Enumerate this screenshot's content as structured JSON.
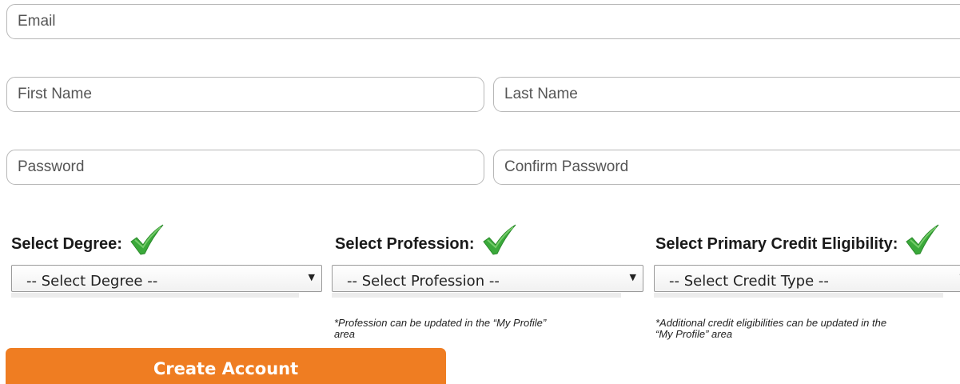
{
  "form": {
    "email": {
      "placeholder": "Email",
      "value": ""
    },
    "first_name": {
      "placeholder": "First Name",
      "value": ""
    },
    "last_name": {
      "placeholder": "Last Name",
      "value": ""
    },
    "password": {
      "placeholder": "Password",
      "value": ""
    },
    "confirm_password": {
      "placeholder": "Confirm Password",
      "value": ""
    }
  },
  "selects": {
    "degree": {
      "label": "Select Degree:",
      "selected": "-- Select Degree --",
      "status_icon": "green-check-icon"
    },
    "profession": {
      "label": "Select Profession:",
      "selected": "-- Select Profession --",
      "status_icon": "green-check-icon",
      "note": "*Profession can be updated in the “My Profile”\narea"
    },
    "credit": {
      "label": "Select Primary Credit Eligibility:",
      "selected": "-- Select Credit Type --",
      "status_icon": "green-check-icon",
      "note": "*Additional credit eligibilities can be updated in the\n“My Profile” area"
    }
  },
  "actions": {
    "create_account_label": "Create Account"
  },
  "colors": {
    "accent_orange": "#ef7d22",
    "check_green": "#3aa93a",
    "input_border": "#b7b7b7"
  }
}
